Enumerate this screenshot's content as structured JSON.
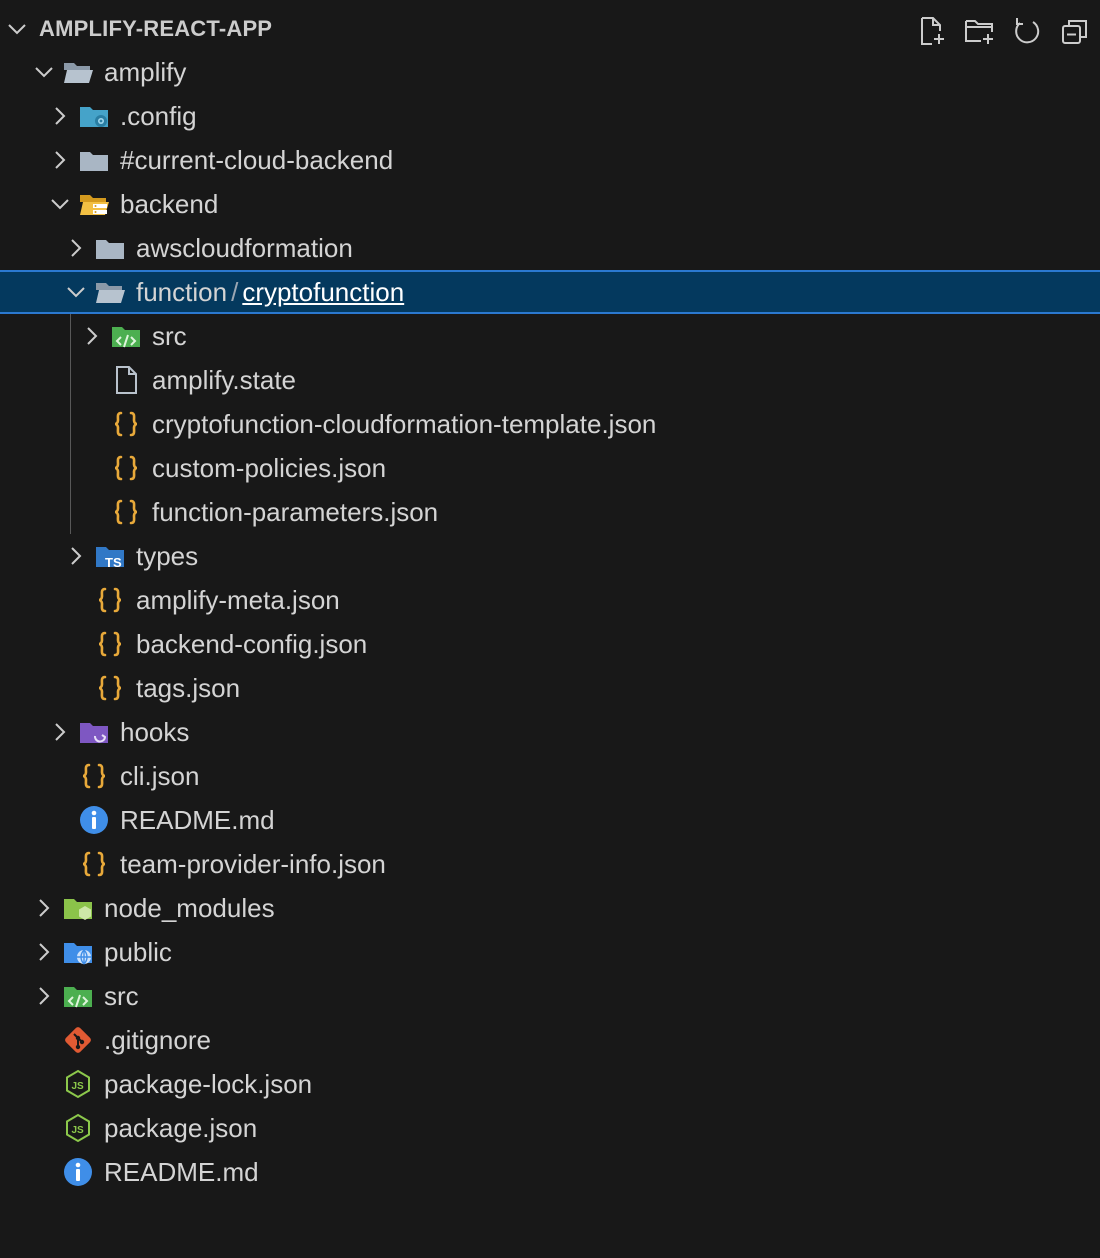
{
  "explorer": {
    "title": "AMPLIFY-REACT-APP",
    "actions": [
      {
        "name": "new-file-button",
        "icon": "new-file-icon"
      },
      {
        "name": "new-folder-button",
        "icon": "new-folder-icon"
      },
      {
        "name": "refresh-button",
        "icon": "refresh-icon"
      },
      {
        "name": "collapse-all-button",
        "icon": "collapse-all-icon"
      }
    ]
  },
  "colors": {
    "background": "#181818",
    "selected_bg": "#04395e",
    "selected_border": "#2b79d0",
    "json_icon": "#e8a93a",
    "info_icon": "#3f8ee8",
    "git_icon": "#e05a33",
    "node_icon": "#8cc84b"
  },
  "tree": [
    {
      "label": "amplify",
      "depth": 1,
      "state": "expanded",
      "icon": "folder-open-icon"
    },
    {
      "label": ".config",
      "depth": 2,
      "state": "collapsed",
      "icon": "folder-config-icon"
    },
    {
      "label": "#current-cloud-backend",
      "depth": 2,
      "state": "collapsed",
      "icon": "folder-icon"
    },
    {
      "label": "backend",
      "depth": 2,
      "state": "expanded",
      "icon": "folder-server-icon"
    },
    {
      "label": "awscloudformation",
      "depth": 3,
      "state": "collapsed",
      "icon": "folder-icon"
    },
    {
      "label": "function",
      "label2": "cryptofunction",
      "separator": "/",
      "depth": 3,
      "state": "expanded",
      "icon": "folder-open-icon",
      "selected": true
    },
    {
      "label": "src",
      "depth": 4,
      "state": "collapsed",
      "icon": "folder-src-icon"
    },
    {
      "label": "amplify.state",
      "depth": 4,
      "state": "file",
      "icon": "file-icon"
    },
    {
      "label": "cryptofunction-cloudformation-template.json",
      "depth": 4,
      "state": "file",
      "icon": "json-icon"
    },
    {
      "label": "custom-policies.json",
      "depth": 4,
      "state": "file",
      "icon": "json-icon"
    },
    {
      "label": "function-parameters.json",
      "depth": 4,
      "state": "file",
      "icon": "json-icon"
    },
    {
      "label": "types",
      "depth": 3,
      "state": "collapsed",
      "icon": "folder-ts-icon"
    },
    {
      "label": "amplify-meta.json",
      "depth": 3,
      "state": "file",
      "icon": "json-icon"
    },
    {
      "label": "backend-config.json",
      "depth": 3,
      "state": "file",
      "icon": "json-icon"
    },
    {
      "label": "tags.json",
      "depth": 3,
      "state": "file",
      "icon": "json-icon"
    },
    {
      "label": "hooks",
      "depth": 2,
      "state": "collapsed",
      "icon": "folder-hooks-icon"
    },
    {
      "label": "cli.json",
      "depth": 2,
      "state": "file",
      "icon": "json-icon"
    },
    {
      "label": "README.md",
      "depth": 2,
      "state": "file",
      "icon": "info-icon"
    },
    {
      "label": "team-provider-info.json",
      "depth": 2,
      "state": "file",
      "icon": "json-icon"
    },
    {
      "label": "node_modules",
      "depth": 1,
      "state": "collapsed",
      "icon": "folder-node-icon"
    },
    {
      "label": "public",
      "depth": 1,
      "state": "collapsed",
      "icon": "folder-public-icon"
    },
    {
      "label": "src",
      "depth": 1,
      "state": "collapsed",
      "icon": "folder-src-icon"
    },
    {
      "label": ".gitignore",
      "depth": 1,
      "state": "file",
      "icon": "git-icon"
    },
    {
      "label": "package-lock.json",
      "depth": 1,
      "state": "file",
      "icon": "nodejs-icon"
    },
    {
      "label": "package.json",
      "depth": 1,
      "state": "file",
      "icon": "nodejs-icon"
    },
    {
      "label": "README.md",
      "depth": 1,
      "state": "file",
      "icon": "info-icon"
    }
  ]
}
